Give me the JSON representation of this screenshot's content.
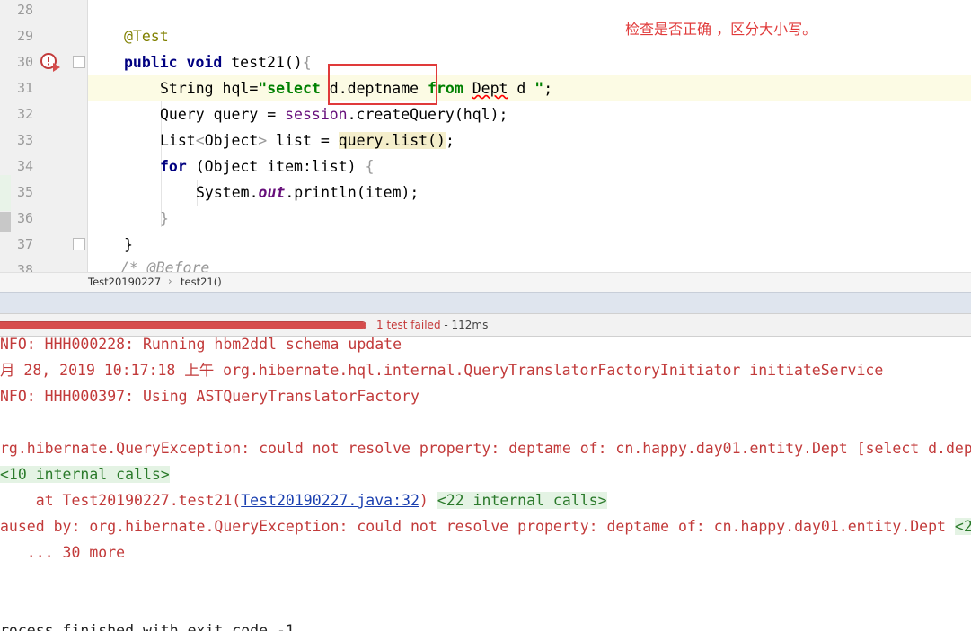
{
  "annotation": {
    "note": "检查是否正确 ，区分大小写。"
  },
  "editor": {
    "line_numbers": [
      "28",
      "29",
      "30",
      "31",
      "32",
      "33",
      "34",
      "35",
      "36",
      "37",
      "38"
    ],
    "code": {
      "l29_annotation": "@Test",
      "l30_public": "public",
      "l30_void": "void",
      "l30_rest": " test21()",
      "l30_brace": "{",
      "l31_a": "String hql=",
      "l31_q1": "\"",
      "l31_select": "select",
      "l31_b": " d.deptname ",
      "l31_from": "from",
      "l31_c": " ",
      "l31_dept": "Dept",
      "l31_d": " d ",
      "l31_q2": "\"",
      "l31_e": ";",
      "l32_a": "Query query = ",
      "l32_session": "session",
      "l32_b": ".createQuery(hql);",
      "l33_a": "List",
      "l33_lt": "<",
      "l33_b": "Object",
      "l33_gt": ">",
      "l33_c": " list = ",
      "l33_d": "query.list()",
      "l33_e": ";",
      "l34_for": "for",
      "l34_a": " (Object item:list) ",
      "l34_brace": "{",
      "l35_a": "System.",
      "l35_out": "out",
      "l35_b": ".println(item);",
      "l36_brace": "}",
      "l37_brace": "}",
      "l38_comment": "/* @Before"
    }
  },
  "breadcrumb": {
    "class_name": "Test20190227",
    "separator": "›",
    "method_name": "test21()"
  },
  "test_status": {
    "failed_label": "1 test failed",
    "duration": " - 112ms",
    "progress_fraction": 1.0
  },
  "console": {
    "line1": "NFO: HHH000228: Running hbm2ddl schema update",
    "line2": "月 28, 2019 10:17:18 上午 org.hibernate.hql.internal.QueryTranslatorFactoryInitiator initiateService",
    "line3": "NFO: HHH000397: Using ASTQueryTranslatorFactory",
    "line4": "rg.hibernate.QueryException: could not resolve property: deptame of: cn.happy.day01.entity.Dept [select d.dep",
    "line5_internal": "<10 internal calls>",
    "line6_prefix": "    at Test20190227.test21(",
    "line6_link": "Test20190227.java:32",
    "line6_suffix": ") ",
    "line6_internal": "<22 internal calls>",
    "line7": "aused by: org.hibernate.QueryException: could not resolve property: deptame of: cn.happy.day01.entity.Dept ",
    "line7_internal": "<2",
    "line8": "   ... 30 more",
    "line9": "rocess finished with exit code -1"
  },
  "colors": {
    "accent_red": "#e03a3a",
    "fail_red": "#d64d4d",
    "internal_green": "#e4f3e4"
  }
}
